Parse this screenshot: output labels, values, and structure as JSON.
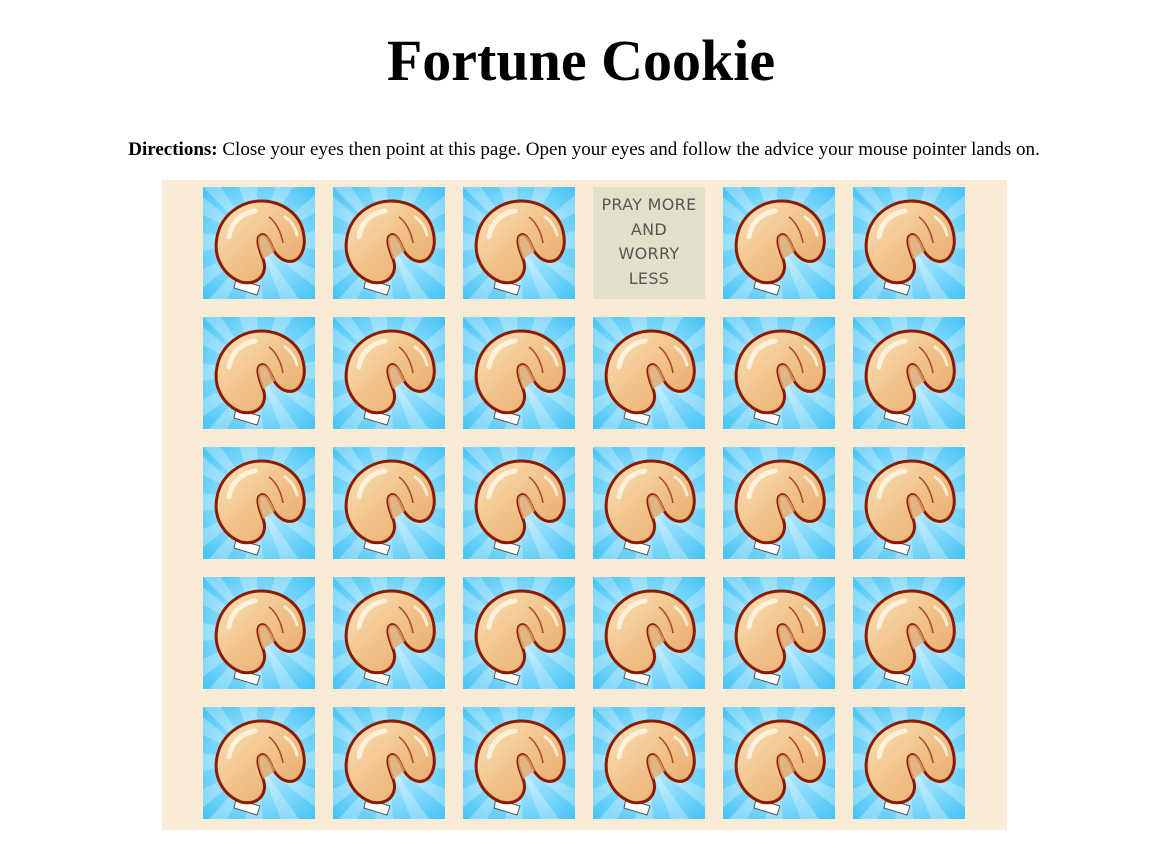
{
  "page": {
    "title": "Fortune Cookie",
    "directions_label": "Directions:",
    "directions_text": " Close your eyes then point at this page. Open your eyes and follow the advice your mouse pointer lands on."
  },
  "colors": {
    "board_background": "#faebd7",
    "tile_sky": "#4fc8f7",
    "tile_sky_light": "#c9efff",
    "cookie_fill": "#f3c992",
    "cookie_outline": "#8b1a00",
    "revealed_background": "#e1e0ca",
    "revealed_text": "#555555"
  },
  "grid": {
    "rows": 5,
    "columns": 6,
    "revealed_tile_index": 3,
    "revealed_fortune": "PRAY MORE AND WORRY LESS"
  },
  "icons": {
    "tile_icon": "fortune-cookie-icon"
  }
}
